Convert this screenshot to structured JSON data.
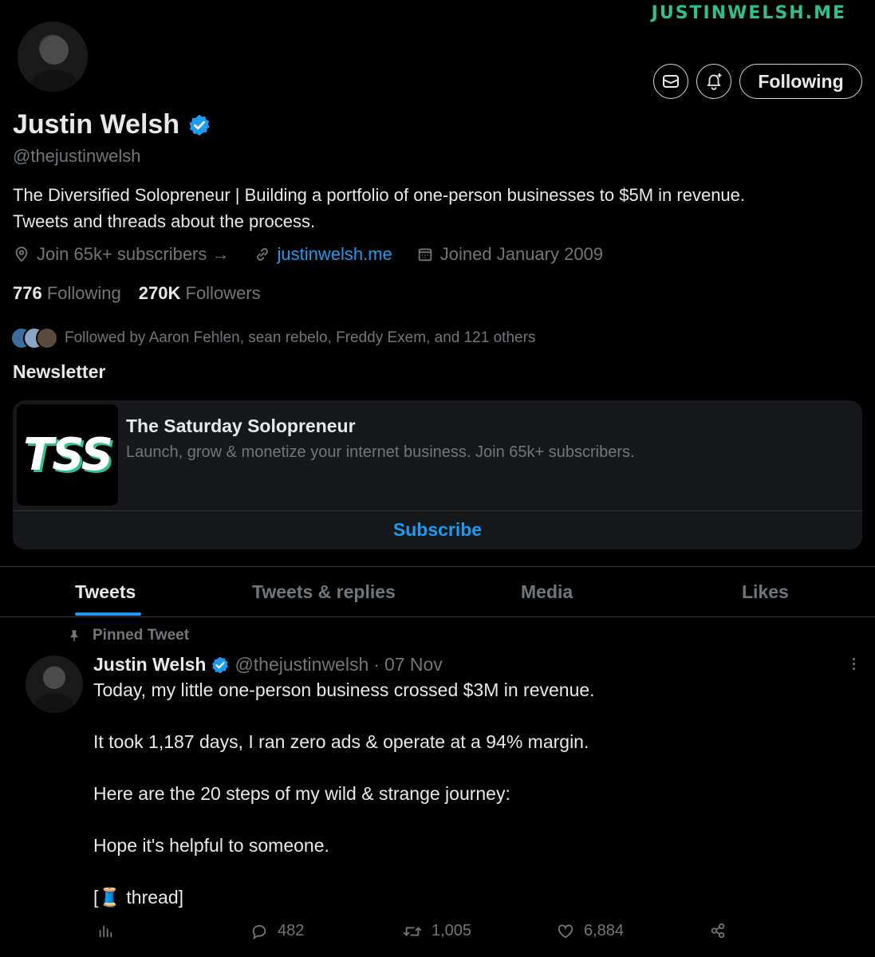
{
  "watermark": "JUSTINWELSH.ME",
  "profile": {
    "name": "Justin Welsh",
    "handle": "@thejustinwelsh",
    "bio_line1": "The Diversified Solopreneur | Building a portfolio of one-person businesses to $5M in revenue.",
    "bio_line2": "Tweets and threads about the process.",
    "location": "Join 65k+ subscribers →",
    "website": "justinwelsh.me",
    "joined": "Joined January 2009",
    "following_count": "776",
    "following_label": "Following",
    "followers_count": "270K",
    "followers_label": "Followers",
    "followed_by": "Followed by Aaron Fehlen, sean rebelo, Freddy Exem, and 121 others",
    "following_button": "Following"
  },
  "newsletter": {
    "section_title": "Newsletter",
    "logo_text": "TSS",
    "title": "The Saturday Solopreneur",
    "description": "Launch, grow & monetize your internet business. Join 65k+ subscribers.",
    "subscribe_label": "Subscribe"
  },
  "tabs": [
    {
      "label": "Tweets",
      "active": true
    },
    {
      "label": "Tweets & replies",
      "active": false
    },
    {
      "label": "Media",
      "active": false
    },
    {
      "label": "Likes",
      "active": false
    }
  ],
  "tweet": {
    "pinned_label": "Pinned Tweet",
    "author_name": "Justin Welsh",
    "author_handle": "@thejustinwelsh",
    "separator": "·",
    "date": "07 Nov",
    "lines": [
      "Today, my little one-person business crossed $3M in revenue.",
      "It took 1,187 days, I ran zero ads & operate at a 94% margin.",
      "Here are the 20 steps of my wild & strange journey:",
      "Hope it's helpful to someone.",
      "[🧵 thread]"
    ],
    "replies": "482",
    "retweets": "1,005",
    "likes": "6,884"
  },
  "colors": {
    "background": "#000000",
    "accent": "#1d9bf0",
    "muted": "#71767b",
    "card": "#16181c",
    "watermark": "#2ec08f"
  },
  "icons": [
    "mail-icon",
    "bell-plus-icon",
    "verified-badge-icon",
    "location-icon",
    "link-icon",
    "calendar-icon",
    "pin-icon",
    "more-icon",
    "analytics-icon",
    "reply-icon",
    "retweet-icon",
    "like-icon",
    "share-icon"
  ]
}
